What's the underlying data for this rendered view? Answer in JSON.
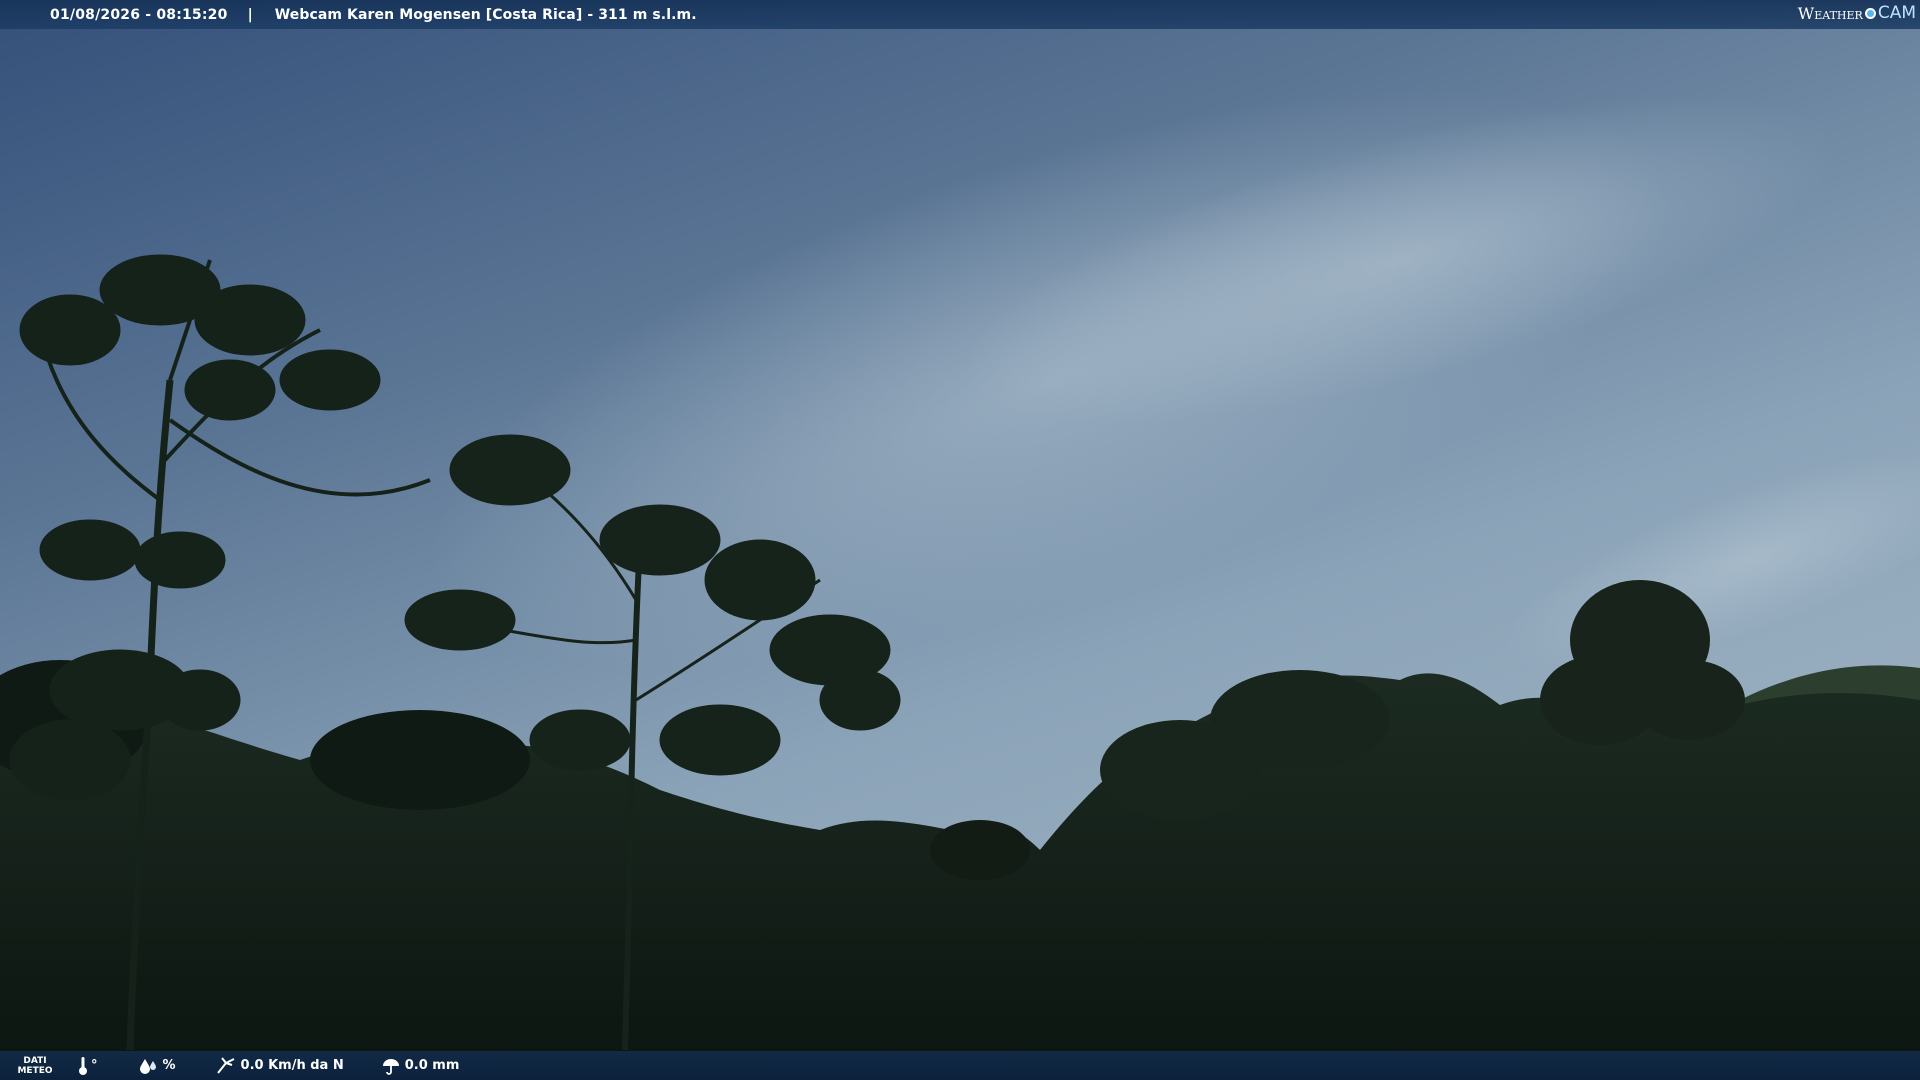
{
  "header": {
    "datetime": "01/08/2026 - 08:15:20",
    "separator": "|",
    "title": "Webcam Karen Mogensen [Costa Rica]  - 311 m s.l.m.",
    "logo_left": "Weather",
    "logo_right": "CAM"
  },
  "footer": {
    "dati_label": "DATI",
    "meteo_label": "METEO",
    "temperature": "°",
    "humidity": "%",
    "wind": "0.0 Km/h da N",
    "rain": "0.0 mm",
    "icons": [
      "thermometer-icon",
      "humidity-icon",
      "wind-icon",
      "rain-icon"
    ]
  },
  "colors": {
    "bar": "#163258",
    "sky_top": "#3e5a80",
    "sky_mid": "#8aa2b8",
    "forest": "#0f1a14"
  }
}
